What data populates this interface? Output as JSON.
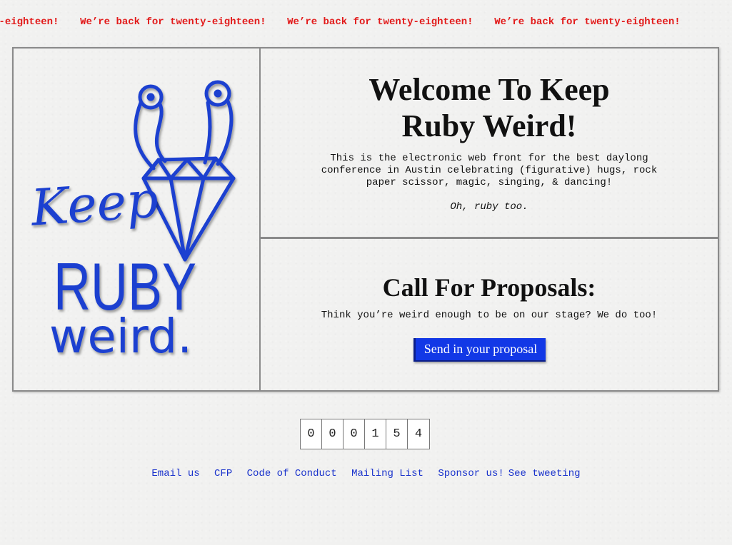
{
  "marquee": {
    "items": [
      "We’re back for twenty-eighteen!",
      "We’re back for twenty-eighteen!",
      "We’re back for twenty-eighteen!",
      "We’re back for twenty-eighteen!"
    ]
  },
  "logo": {
    "line1": "Keep",
    "line2": "RUBY",
    "line3": "weird."
  },
  "welcome": {
    "title": "Welcome To Keep Ruby Weird!",
    "text": "This is the electronic web front for the best daylong conference in Austin celebrating (figurative) hugs, rock paper scissor, magic, singing, & dancing!",
    "aside": "Oh, ruby too."
  },
  "cfp": {
    "title": "Call For Proposals:",
    "text": "Think you’re weird enough to be on our stage? We do too!",
    "button_label": "Send in your proposal"
  },
  "counter": {
    "digits": [
      "0",
      "0",
      "0",
      "1",
      "5",
      "4"
    ]
  },
  "footer": {
    "links": [
      "Email us",
      "CFP",
      "Code of Conduct",
      "Mailing List",
      "Sponsor us!",
      "See tweeting"
    ]
  },
  "colors": {
    "marquee": "#e21a1a",
    "logo": "#1a3fd0",
    "button": "#1238e6",
    "link": "#1a33cc"
  }
}
